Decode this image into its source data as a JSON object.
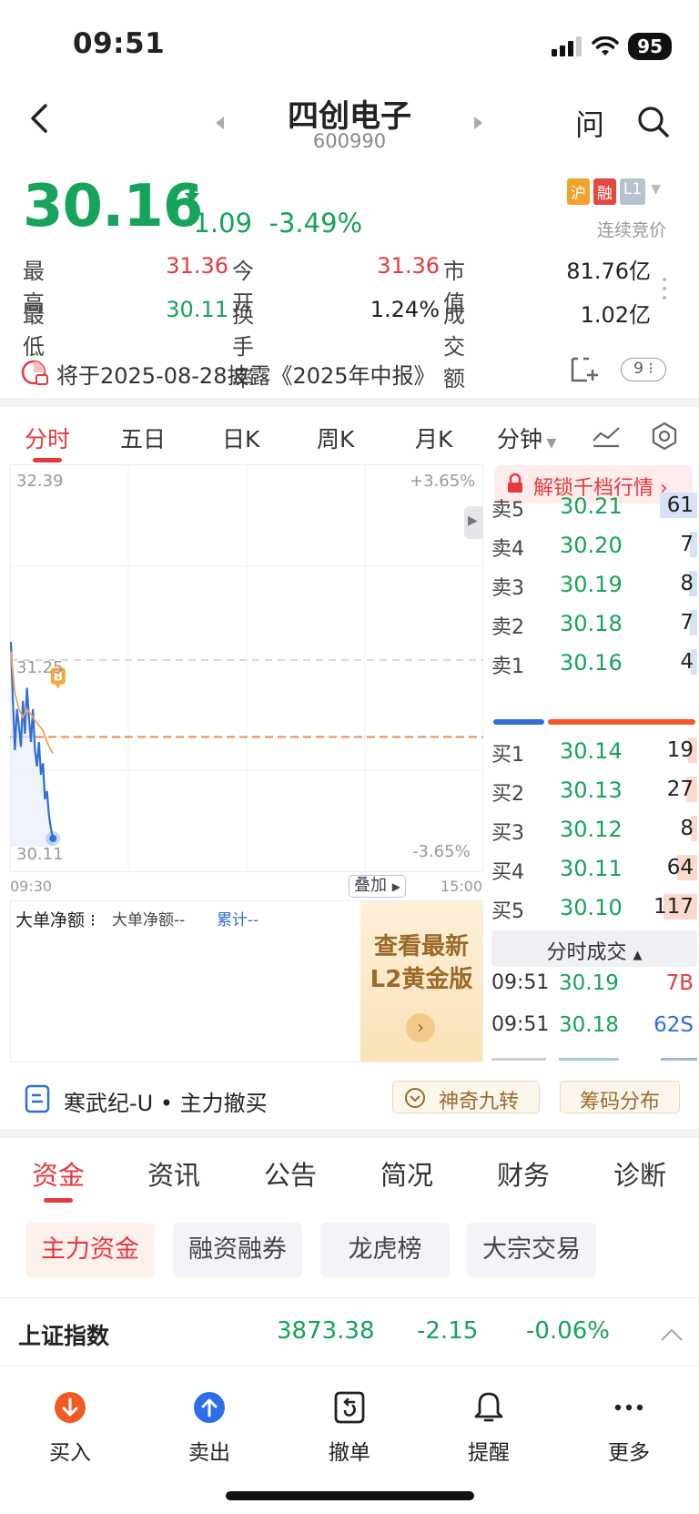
{
  "status": {
    "time": "09:51",
    "battery": "95"
  },
  "nav": {
    "title": "四创电子",
    "code": "600990",
    "ask": "问"
  },
  "quote": {
    "price": "30.16",
    "change": "-1.09",
    "change_pct": "-3.49%",
    "badges": [
      "沪",
      "融",
      "L1"
    ],
    "trade_state": "连续竞价",
    "stats": [
      {
        "label": "最　高",
        "value": "31.36",
        "color": "red"
      },
      {
        "label": "今　开",
        "value": "31.36",
        "color": "red"
      },
      {
        "label": "市　值",
        "value": "81.76亿",
        "color": "black"
      },
      {
        "label": "最　低",
        "value": "30.11",
        "color": "green"
      },
      {
        "label": "换手率",
        "value": "1.24%",
        "color": "black"
      },
      {
        "label": "成交额",
        "value": "1.02亿",
        "color": "black"
      }
    ]
  },
  "disclosure": {
    "text": "将于2025-08-28披露《2025年中报》",
    "count": "9"
  },
  "chart_tabs": [
    "分时",
    "五日",
    "日K",
    "周K",
    "月K",
    "分钟"
  ],
  "chart": {
    "y_top": "32.39",
    "y_mid": "31.25",
    "y_bottom": "30.11",
    "pct_top": "+3.65%",
    "pct_bottom": "-3.65%",
    "x_start": "09:30",
    "x_end": "15:00",
    "overlay": "叠加",
    "marker": "B"
  },
  "chart_data": {
    "type": "line",
    "title": "",
    "xlabel": "",
    "ylabel": "",
    "x_range": [
      "09:30",
      "15:00"
    ],
    "ylim": [
      30.11,
      32.39
    ],
    "reference_price": 31.25,
    "series": [
      {
        "name": "",
        "color": "#2f6fd6",
        "x": [
          0,
          1,
          2,
          3,
          4,
          5,
          6,
          7,
          8,
          9,
          10,
          11,
          12,
          13,
          14,
          15,
          16,
          17,
          18,
          19,
          20,
          21
        ],
        "y": [
          31.36,
          31.0,
          30.7,
          30.95,
          30.85,
          30.72,
          31.0,
          30.8,
          31.08,
          30.9,
          30.75,
          30.95,
          30.7,
          30.6,
          30.75,
          30.55,
          30.62,
          30.4,
          30.45,
          30.3,
          30.22,
          30.16
        ]
      },
      {
        "name": "",
        "color": "#f0a060",
        "x": [
          0,
          2,
          4,
          6,
          8,
          10,
          12,
          14,
          16,
          18,
          20,
          21
        ],
        "y": [
          31.3,
          31.05,
          30.95,
          30.9,
          30.95,
          30.92,
          30.88,
          30.85,
          30.82,
          30.75,
          30.7,
          30.68
        ]
      }
    ]
  },
  "bigorder": {
    "title": "大单净额",
    "sub": "大单净额--",
    "cum": "累计--",
    "promo": "查看最新L2黄金版"
  },
  "orderbook": {
    "unlock": "解锁千档行情",
    "asks": [
      {
        "label": "卖5",
        "price": "30.21",
        "vol": "61",
        "fill": 0.62
      },
      {
        "label": "卖4",
        "price": "30.20",
        "vol": "7",
        "fill": 0.07
      },
      {
        "label": "卖3",
        "price": "30.19",
        "vol": "8",
        "fill": 0.08
      },
      {
        "label": "卖2",
        "price": "30.18",
        "vol": "7",
        "fill": 0.07
      },
      {
        "label": "卖1",
        "price": "30.16",
        "vol": "4",
        "fill": 0.05
      }
    ],
    "bids": [
      {
        "label": "买1",
        "price": "30.14",
        "vol": "19",
        "fill": 0.1
      },
      {
        "label": "买2",
        "price": "30.13",
        "vol": "27",
        "fill": 0.13
      },
      {
        "label": "买3",
        "price": "30.12",
        "vol": "8",
        "fill": 0.05
      },
      {
        "label": "买4",
        "price": "30.11",
        "vol": "64",
        "fill": 0.3
      },
      {
        "label": "买5",
        "price": "30.10",
        "vol": "117",
        "fill": 0.55
      }
    ],
    "buy_ratio": 0.26,
    "ticks_title": "分时成交",
    "ticks": [
      {
        "time": "09:51",
        "price": "30.19",
        "vol": "7B",
        "color": "red"
      },
      {
        "time": "09:51",
        "price": "30.18",
        "vol": "62S",
        "color": "blue"
      }
    ]
  },
  "news": {
    "text": "寒武纪-U • 主力撤买",
    "magic": "神奇九转",
    "chips": "筹码分布"
  },
  "bottom_tabs": [
    "资金",
    "资讯",
    "公告",
    "简况",
    "财务",
    "诊断"
  ],
  "sub_tabs": [
    "主力资金",
    "融资融券",
    "龙虎榜",
    "大宗交易"
  ],
  "index": {
    "name": "上证指数",
    "value": "3873.38",
    "change": "-2.15",
    "pct": "-0.06%"
  },
  "bottom_bar": [
    {
      "label": "买入",
      "icon": "buy-icon"
    },
    {
      "label": "卖出",
      "icon": "sell-icon"
    },
    {
      "label": "撤单",
      "icon": "cancel-order-icon"
    },
    {
      "label": "提醒",
      "icon": "bell-icon"
    },
    {
      "label": "更多",
      "icon": "more-icon"
    }
  ]
}
